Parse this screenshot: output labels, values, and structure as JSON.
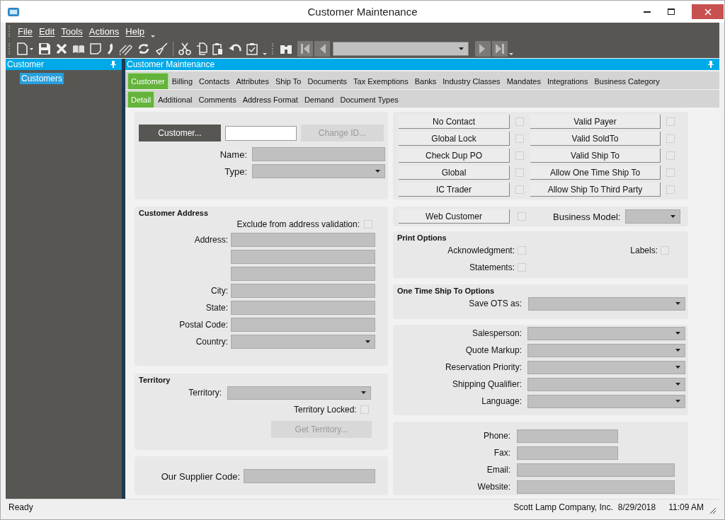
{
  "window": {
    "title": "Customer Maintenance"
  },
  "menu": [
    {
      "label": "File"
    },
    {
      "label": "Edit"
    },
    {
      "label": "Tools"
    },
    {
      "label": "Actions"
    },
    {
      "label": "Help"
    }
  ],
  "navigator": {
    "title": "Customer",
    "items": [
      {
        "label": "Customers",
        "selected": true
      }
    ]
  },
  "main": {
    "title": "Customer Maintenance"
  },
  "tabs": [
    {
      "label": "Customer",
      "selected": true
    },
    {
      "label": "Billing",
      "selected": false
    },
    {
      "label": "Contacts",
      "selected": false
    },
    {
      "label": "Attributes",
      "selected": false
    },
    {
      "label": "Ship To",
      "selected": false
    },
    {
      "label": "Documents",
      "selected": false
    },
    {
      "label": "Tax Exemptions",
      "selected": false
    },
    {
      "label": "Banks",
      "selected": false
    },
    {
      "label": "Industry Classes",
      "selected": false
    },
    {
      "label": "Mandates",
      "selected": false
    },
    {
      "label": "Integrations",
      "selected": false
    },
    {
      "label": "Business Category",
      "selected": false
    }
  ],
  "subtabs": [
    {
      "label": "Detail",
      "selected": true
    },
    {
      "label": "Additional",
      "selected": false
    },
    {
      "label": "Comments",
      "selected": false
    },
    {
      "label": "Address Format",
      "selected": false
    },
    {
      "label": "Demand",
      "selected": false
    },
    {
      "label": "Document Types",
      "selected": false
    }
  ],
  "customer": {
    "button": "Customer...",
    "change_id": {
      "label": "Change ID...",
      "disabled": true
    },
    "fields": [
      {
        "label": "Name:",
        "kind": "text"
      },
      {
        "label": "Type:",
        "kind": "dropdown"
      }
    ]
  },
  "address": {
    "title": "Customer Address",
    "exclude": {
      "label": "Exclude from address validation:",
      "checked": false
    },
    "fields": [
      {
        "label": "Address:",
        "kind": "text"
      },
      {
        "kind": "text"
      },
      {
        "kind": "text"
      },
      {
        "label": "City:",
        "kind": "text"
      },
      {
        "label": "State:",
        "kind": "text"
      },
      {
        "label": "Postal Code:",
        "kind": "text"
      },
      {
        "label": "Country:",
        "kind": "dropdown"
      }
    ]
  },
  "territory": {
    "title": "Territory",
    "field": {
      "label": "Territory:",
      "kind": "dropdown"
    },
    "locked": {
      "label": "Territory Locked:",
      "checked": false
    },
    "button": {
      "label": "Get Territory...",
      "disabled": true
    }
  },
  "supplier": {
    "field": {
      "label": "Our Supplier Code:"
    }
  },
  "flags": [
    {
      "label": "No Contact",
      "checked": false
    },
    {
      "label": "Global Lock",
      "checked": false
    },
    {
      "label": "Check Dup PO",
      "checked": false
    },
    {
      "label": "Global",
      "checked": false
    },
    {
      "label": "IC Trader",
      "checked": false
    }
  ],
  "validity": [
    {
      "label": "Valid Payer",
      "checked": false
    },
    {
      "label": "Valid SoldTo",
      "checked": false
    },
    {
      "label": "Valid Ship To",
      "checked": false
    },
    {
      "label": "Allow One Time Ship To",
      "checked": false
    },
    {
      "label": "Allow Ship To Third Party",
      "checked": false
    }
  ],
  "web": {
    "label": "Web Customer",
    "checked": false,
    "business_model": {
      "label": "Business Model:",
      "kind": "dropdown"
    }
  },
  "print_options": {
    "title": "Print Options",
    "acknowledgment": {
      "label": "Acknowledgment:",
      "checked": false
    },
    "labels": {
      "label": "Labels:",
      "checked": false
    },
    "statements": {
      "label": "Statements:",
      "checked": false
    }
  },
  "ots": {
    "title": "One Time Ship To Options",
    "field": {
      "label": "Save OTS as:",
      "kind": "dropdown"
    }
  },
  "sales": [
    {
      "label": "Salesperson:",
      "kind": "dropdown"
    },
    {
      "label": "Quote Markup:",
      "kind": "dropdown"
    },
    {
      "label": "Reservation Priority:",
      "kind": "dropdown"
    },
    {
      "label": "Shipping Qualifier:",
      "kind": "dropdown"
    },
    {
      "label": "Language:",
      "kind": "dropdown"
    }
  ],
  "contact": [
    {
      "label": "Phone:",
      "kind": "short"
    },
    {
      "label": "Fax:",
      "kind": "short"
    },
    {
      "label": "Email:",
      "kind": "text"
    },
    {
      "label": "Website:",
      "kind": "text"
    }
  ],
  "status_bar": {
    "message": "Ready",
    "company": "Scott Lamp Company, Inc.",
    "date": "8/29/2018",
    "time": "11:09 AM"
  }
}
